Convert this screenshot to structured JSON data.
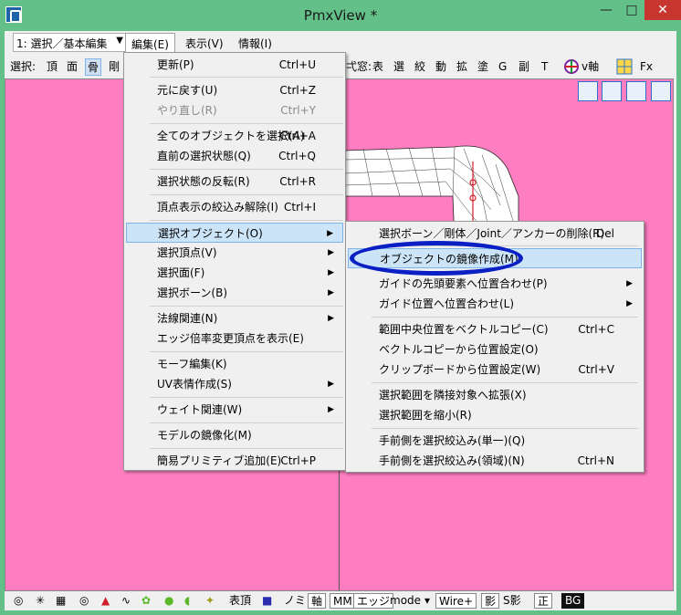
{
  "window": {
    "title": "PmxView *",
    "min": "—",
    "max": "□",
    "close": "✕"
  },
  "menubar": {
    "mode": "1: 選択／基本編集",
    "items": [
      "編集(E)",
      "表示(V)",
      "情報(I)"
    ]
  },
  "toolbar": {
    "select_label": "選択:",
    "items": [
      "頂",
      "面",
      "骨",
      "剛"
    ],
    "right_items": [
      "表",
      "選",
      "絞",
      "動",
      "拡",
      "塗",
      "G",
      "副",
      "T"
    ],
    "partial": "弌窓:",
    "v_label": "v軸",
    "fx_label": "Fx"
  },
  "edit_menu": {
    "items": [
      {
        "label": "更新(P)",
        "shortcut": "Ctrl+U"
      },
      {
        "label": "元に戻す(U)",
        "shortcut": "Ctrl+Z"
      },
      {
        "label": "やり直し(R)",
        "shortcut": "Ctrl+Y"
      },
      {
        "label": "全てのオブジェクトを選択(A)",
        "shortcut": "Ctrl+A"
      },
      {
        "label": "直前の選択状態(Q)",
        "shortcut": "Ctrl+Q"
      },
      {
        "label": "選択状態の反転(R)",
        "shortcut": "Ctrl+R"
      },
      {
        "label": "頂点表示の絞込み解除(I)",
        "shortcut": "Ctrl+I"
      },
      {
        "label": "選択オブジェクト(O)",
        "shortcut": ""
      },
      {
        "label": "選択頂点(V)",
        "shortcut": ""
      },
      {
        "label": "選択面(F)",
        "shortcut": ""
      },
      {
        "label": "選択ボーン(B)",
        "shortcut": ""
      },
      {
        "label": "法線関連(N)",
        "shortcut": ""
      },
      {
        "label": "エッジ倍率変更頂点を表示(E)",
        "shortcut": ""
      },
      {
        "label": "モーフ編集(K)",
        "shortcut": ""
      },
      {
        "label": "UV表情作成(S)",
        "shortcut": ""
      },
      {
        "label": "ウェイト関連(W)",
        "shortcut": ""
      },
      {
        "label": "モデルの鏡像化(M)",
        "shortcut": ""
      },
      {
        "label": "簡易プリミティブ追加(E)",
        "shortcut": "Ctrl+P"
      }
    ]
  },
  "sub_menu": {
    "items": [
      {
        "label": "選択ボーン／剛体／Joint／アンカーの削除(R)",
        "shortcut": "Del"
      },
      {
        "label": "オブジェクトの鏡像作成(M)",
        "shortcut": ""
      },
      {
        "label": "ガイドの先頭要素へ位置合わせ(P)",
        "shortcut": ""
      },
      {
        "label": "ガイド位置へ位置合わせ(L)",
        "shortcut": ""
      },
      {
        "label": "範囲中央位置をベクトルコピー(C)",
        "shortcut": "Ctrl+C"
      },
      {
        "label": "ベクトルコピーから位置設定(O)",
        "shortcut": ""
      },
      {
        "label": "クリップボードから位置設定(W)",
        "shortcut": "Ctrl+V"
      },
      {
        "label": "選択範囲を隣接対象へ拡張(X)",
        "shortcut": ""
      },
      {
        "label": "選択範囲を縮小(R)",
        "shortcut": ""
      },
      {
        "label": "手前側を選択絞込み(単一)(Q)",
        "shortcut": ""
      },
      {
        "label": "手前側を選択絞込み(領域)(N)",
        "shortcut": "Ctrl+N"
      }
    ]
  },
  "bottombar": {
    "vertex": "表頂",
    "no": "ノミ",
    "axis": "軸",
    "mmd": "MMD",
    "edge": "エッジ",
    "mode": "mode",
    "wire": "Wire+",
    "shadow": "影",
    "sshadow": "S影",
    "front": "正",
    "bg": "BG"
  },
  "colors": {
    "viewport": "#ff7ec2",
    "titlebar": "#63c089",
    "highlight": "#cce4f7",
    "annotation": "#0a1fc4"
  }
}
